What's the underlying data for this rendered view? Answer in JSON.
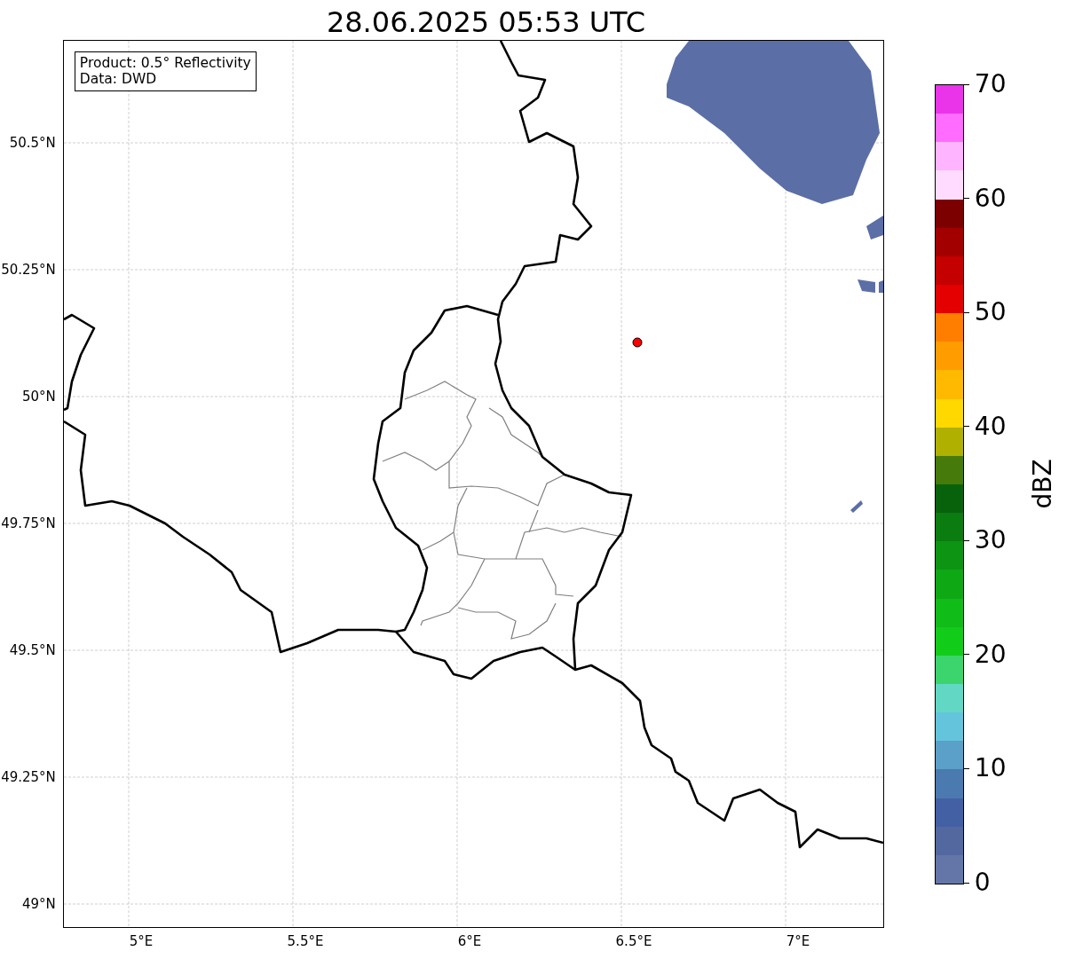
{
  "title": "28.06.2025 05:53 UTC",
  "map": {
    "annotation": [
      "Product: 0.5° Reflectivity",
      "Data: DWD"
    ],
    "xticks": [
      "5°E",
      "5.5°E",
      "6°E",
      "6.5°E",
      "7°E"
    ],
    "yticks": [
      "50.5°N",
      "50.25°N",
      "50°N",
      "49.75°N",
      "49.5°N",
      "49.25°N",
      "49°N"
    ]
  },
  "colorbar": {
    "label": "dBZ",
    "ticks": [
      "70",
      "60",
      "50",
      "40",
      "30",
      "20",
      "10",
      "0"
    ],
    "bins": [
      {
        "color": "#6476a8"
      },
      {
        "color": "#5468a0"
      },
      {
        "color": "#4460a4"
      },
      {
        "color": "#4a7ab0"
      },
      {
        "color": "#5aa0c8"
      },
      {
        "color": "#64c4dc"
      },
      {
        "color": "#62d8c4"
      },
      {
        "color": "#3cd46c"
      },
      {
        "color": "#12cc1a"
      },
      {
        "color": "#10bc18"
      },
      {
        "color": "#0ea814"
      },
      {
        "color": "#0c9412"
      },
      {
        "color": "#0a7c10"
      },
      {
        "color": "#08620c"
      },
      {
        "color": "#467a0a"
      },
      {
        "color": "#b0b000"
      },
      {
        "color": "#ffd800"
      },
      {
        "color": "#ffba00"
      },
      {
        "color": "#ff9c00"
      },
      {
        "color": "#ff7e00"
      },
      {
        "color": "#e40000"
      },
      {
        "color": "#c40000"
      },
      {
        "color": "#a20000"
      },
      {
        "color": "#7c0000"
      },
      {
        "color": "#ffdcff"
      },
      {
        "color": "#ffb4ff"
      },
      {
        "color": "#ff6cff"
      },
      {
        "color": "#ea34ea"
      }
    ]
  }
}
